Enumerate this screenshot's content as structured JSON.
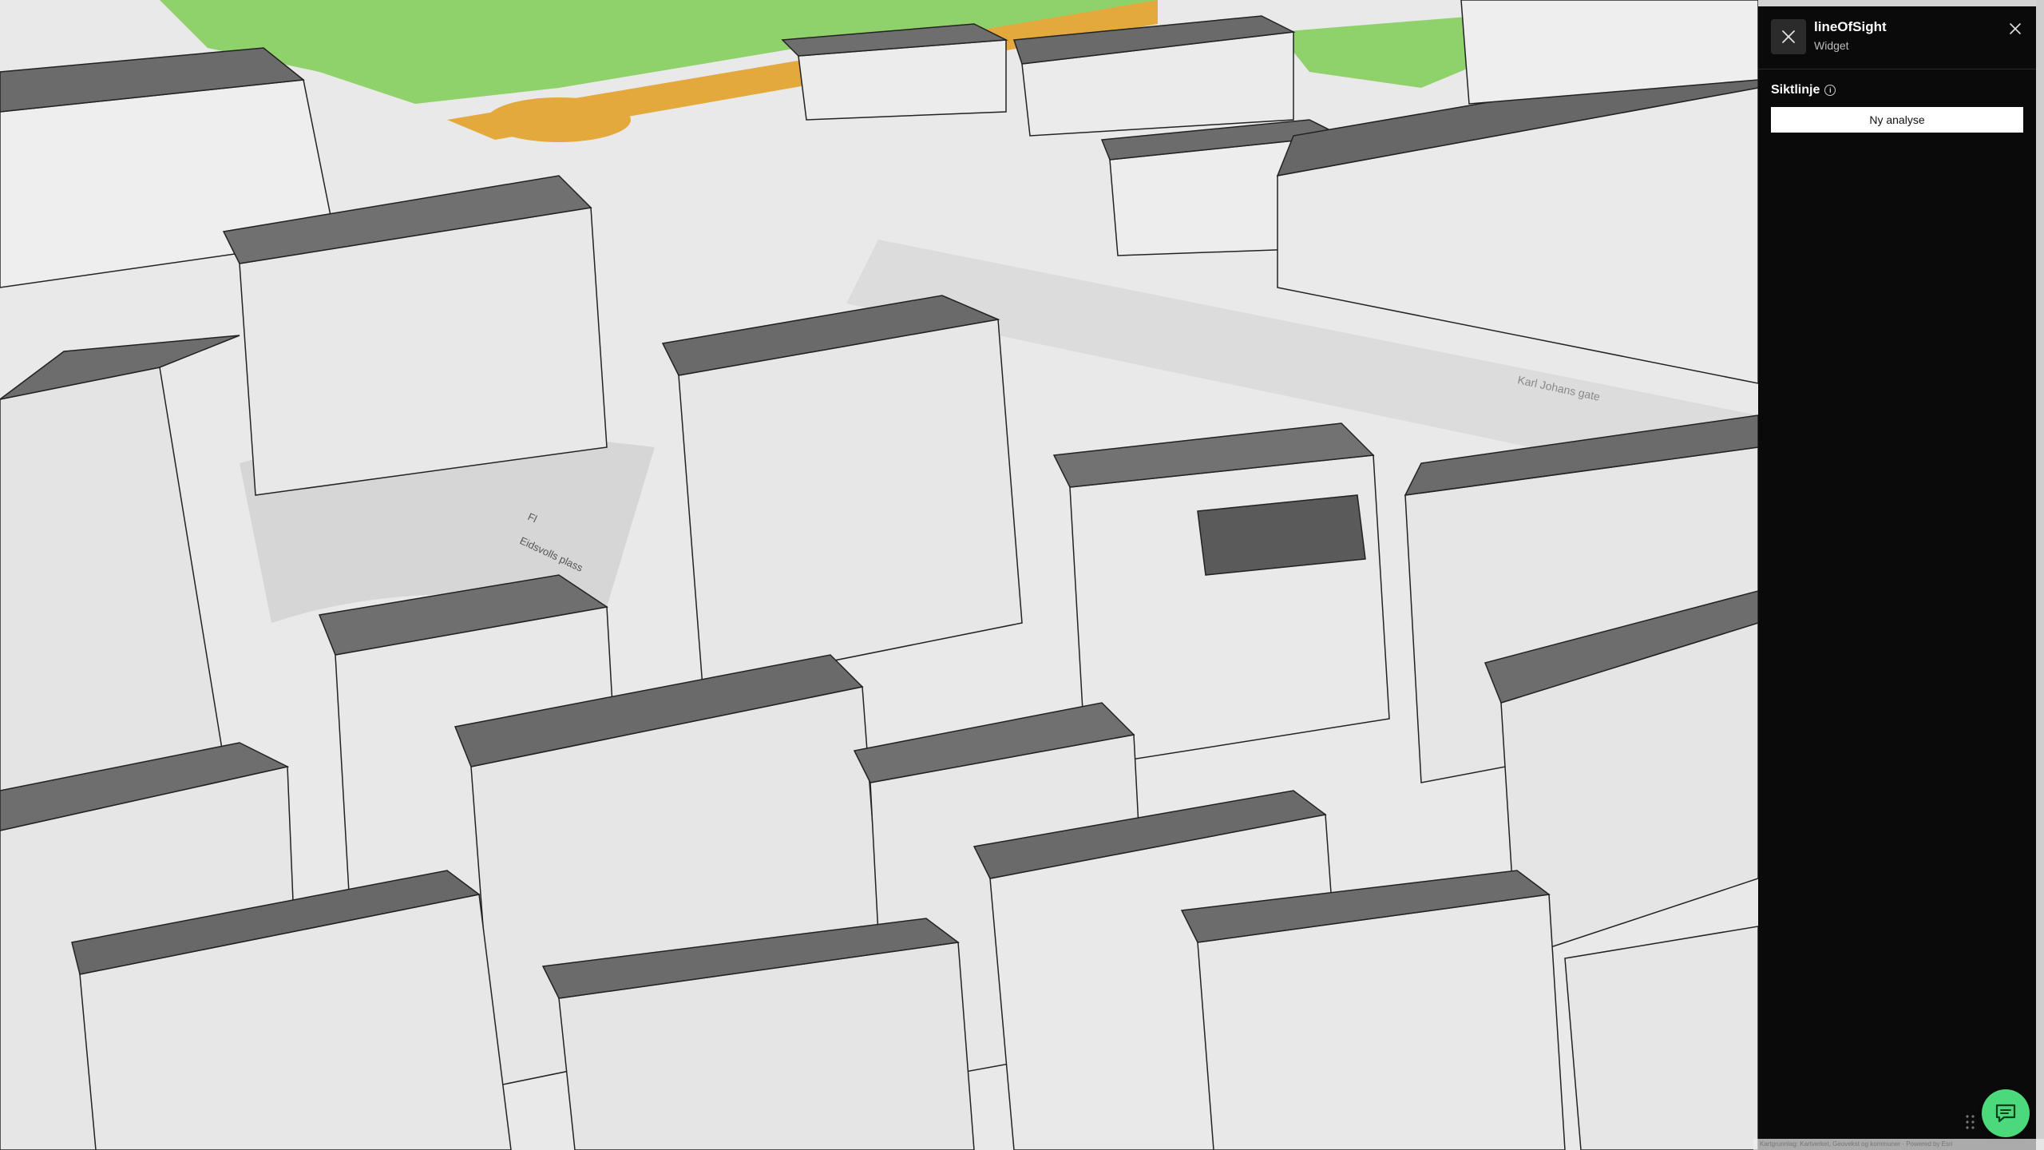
{
  "map": {
    "street_label": "Karl Johans gate",
    "square_label_1": "Eidsvolls plass",
    "square_label_2": "Fl"
  },
  "panel": {
    "widget_name": "lineOfSight",
    "widget_type": "Widget",
    "section_title": "Siktlinje",
    "button_label": "Ny analyse",
    "icon_names": {
      "widget": "line-of-sight-tool-icon",
      "close": "close-icon",
      "info": "info-icon",
      "chat": "chat-icon",
      "drag": "drag-handle-icon"
    }
  },
  "attribution": "Kartgrunnlag: Kartverket, Geovekst og kommuner · Powered by Esri",
  "colors": {
    "panel_bg": "#0a0a0a",
    "button_bg": "#ffffff",
    "chat_bg": "#4cd97b",
    "park_green": "#8fd16a",
    "road_orange": "#e3a93c",
    "building_light": "#e8e8e8",
    "building_dark": "#6b6b6b"
  }
}
